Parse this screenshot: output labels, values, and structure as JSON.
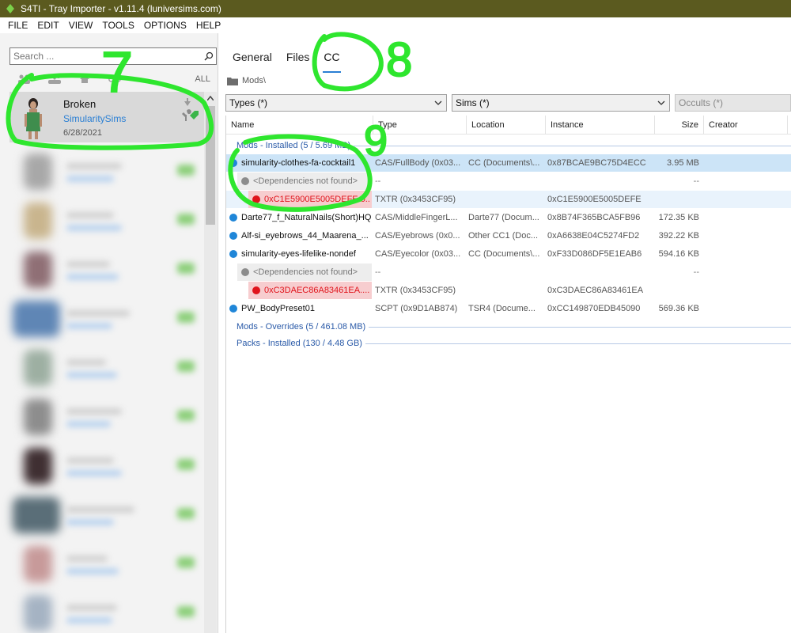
{
  "window": {
    "title": "S4TI - Tray Importer - v1.11.4  (luniversims.com)"
  },
  "menu": [
    "FILE",
    "EDIT",
    "VIEW",
    "TOOLS",
    "OPTIONS",
    "HELP"
  ],
  "left": {
    "search_placeholder": "Search ...",
    "filter_all": "ALL",
    "selected": {
      "name": "Broken",
      "author": "SimularitySims",
      "date": "6/28/2021"
    }
  },
  "tabs": [
    "General",
    "Files",
    "CC"
  ],
  "breadcrumb": "Mods\\",
  "filters": {
    "types": "Types (*)",
    "sims": "Sims (*)",
    "occults": "Occults (*)"
  },
  "columns": {
    "name": "Name",
    "type": "Type",
    "location": "Location",
    "instance": "Instance",
    "size": "Size",
    "creator": "Creator"
  },
  "groups": {
    "mods_installed": "Mods - Installed  (5 / 5.69 MB)",
    "mods_overrides": "Mods - Overrides  (5 / 461.08 MB)",
    "packs_installed": "Packs - Installed  (130 / 4.48 GB)"
  },
  "rows": [
    {
      "name": "simularity-clothes-fa-cocktail1",
      "type": "CAS/FullBody (0x03...",
      "location": "CC (Documents\\...",
      "instance": "0x87BCAE9BC75D4ECC",
      "size": "3.95 MB"
    },
    {
      "name": "<Dependencies not found>",
      "type": "--",
      "location": "",
      "instance": "",
      "size": "--"
    },
    {
      "name": "0xC1E5900E5005DEFE.0...",
      "type": "TXTR (0x3453CF95)",
      "location": "",
      "instance": "0xC1E5900E5005DEFE",
      "size": ""
    },
    {
      "name": "Darte77_f_NaturalNails(Short)HQ",
      "type": "CAS/MiddleFingerL...",
      "location": "Darte77 (Docum...",
      "instance": "0x8B74F365BCA5FB96",
      "size": "172.35 KB"
    },
    {
      "name": "Alf-si_eyebrows_44_Maarena_...",
      "type": "CAS/Eyebrows (0x0...",
      "location": "Other CC1 (Doc...",
      "instance": "0xA6638E04C5274FD2",
      "size": "392.22 KB"
    },
    {
      "name": "simularity-eyes-lifelike-nondef",
      "type": "CAS/Eyecolor (0x03...",
      "location": "CC (Documents\\...",
      "instance": "0xF33D086DF5E1EAB6",
      "size": "594.16 KB"
    },
    {
      "name": "<Dependencies not found>",
      "type": "--",
      "location": "",
      "instance": "",
      "size": "--"
    },
    {
      "name": "0xC3DAEC86A83461EA....",
      "type": "TXTR (0x3453CF95)",
      "location": "",
      "instance": "0xC3DAEC86A83461EA",
      "size": ""
    },
    {
      "name": "PW_BodyPreset01",
      "type": "SCPT (0x9D1AB874)",
      "location": "TSR4 (Docume...",
      "instance": "0xCC149870EDB45090",
      "size": "569.36 KB"
    }
  ],
  "annotations": [
    "7",
    "8",
    "9"
  ],
  "colors": {
    "titlebar": "#5b5a1f",
    "accent": "#2a7fd4",
    "selected_row": "#cce4f7",
    "annotation": "#2ee62e"
  }
}
